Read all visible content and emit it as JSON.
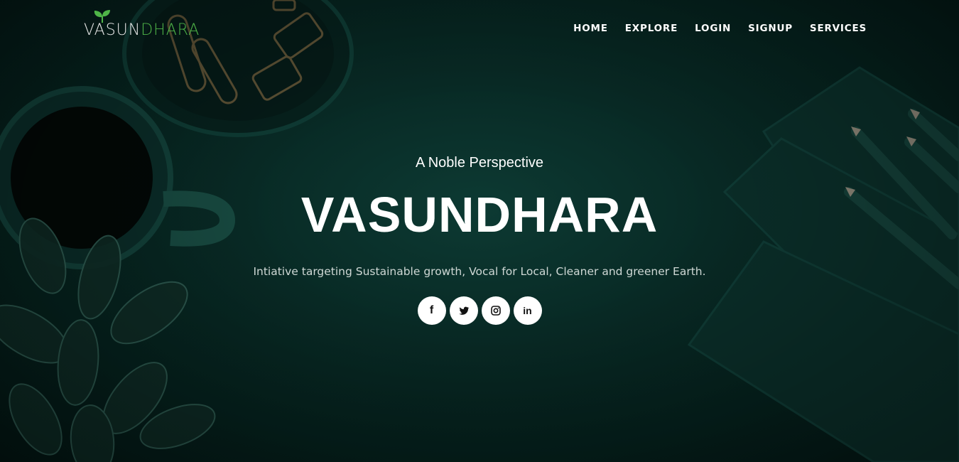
{
  "logo": {
    "part1": "V",
    "part2": "ASUN",
    "part3": "DHARA"
  },
  "nav": {
    "items": [
      {
        "label": "HOME"
      },
      {
        "label": "EXPLORE"
      },
      {
        "label": "LOGIN"
      },
      {
        "label": "SIGNUP"
      },
      {
        "label": "SERVICES"
      }
    ]
  },
  "hero": {
    "tagline": "A Noble Perspective",
    "title": "VASUNDHARA",
    "subtitle": "Intiative targeting Sustainable growth, Vocal for Local, Cleaner and greener Earth."
  },
  "socials": [
    {
      "icon": "facebook-icon",
      "glyph": "f"
    },
    {
      "icon": "twitter-icon"
    },
    {
      "icon": "instagram-icon"
    },
    {
      "icon": "linkedin-icon",
      "glyph": "in"
    }
  ],
  "colors": {
    "background": "#082a25",
    "logo_green": "#4fb548",
    "text": "#ffffff"
  }
}
